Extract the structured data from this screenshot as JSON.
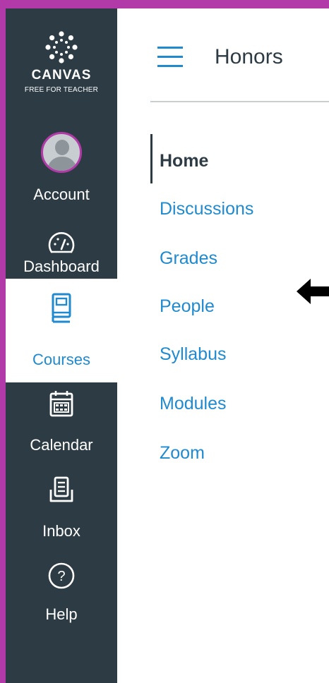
{
  "brand": {
    "name": "CANVAS",
    "tagline": "FREE FOR TEACHER"
  },
  "global_nav": [
    {
      "label": "Account",
      "icon": "avatar",
      "active": false
    },
    {
      "label": "Dashboard",
      "icon": "dashboard-icon",
      "active": false
    },
    {
      "label": "Courses",
      "icon": "courses-book-icon",
      "active": true
    },
    {
      "label": "Calendar",
      "icon": "calendar-icon",
      "active": false
    },
    {
      "label": "Inbox",
      "icon": "inbox-icon",
      "active": false
    },
    {
      "label": "Help",
      "icon": "help-icon",
      "active": false
    }
  ],
  "header": {
    "course_title": "Honors"
  },
  "course_nav": [
    {
      "label": "Home",
      "active": true
    },
    {
      "label": "Discussions",
      "active": false
    },
    {
      "label": "Grades",
      "active": false
    },
    {
      "label": "People",
      "active": false
    },
    {
      "label": "Syllabus",
      "active": false
    },
    {
      "label": "Modules",
      "active": false
    },
    {
      "label": "Zoom",
      "active": false
    }
  ],
  "colors": {
    "nav_background": "#2d3b45",
    "accent_blue": "#1f8ad0",
    "frame_purple": "#b13aa8"
  }
}
